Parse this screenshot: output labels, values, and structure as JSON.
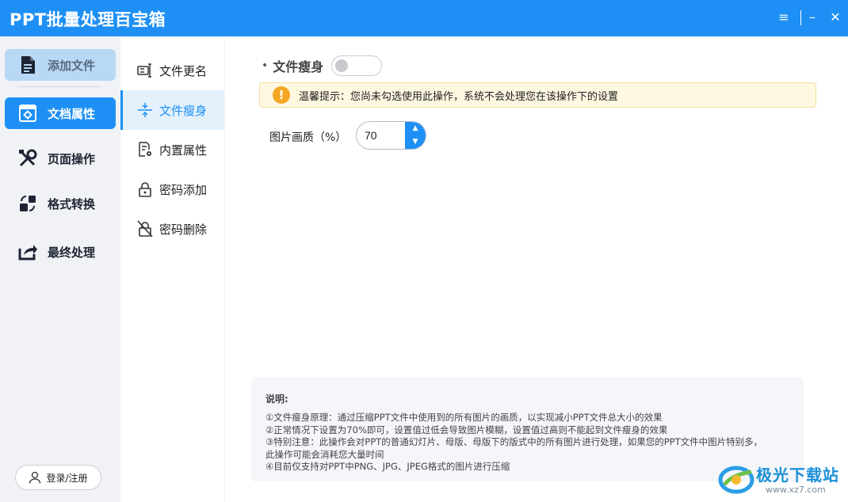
{
  "app": {
    "title": "PPT批量处理百宝箱"
  },
  "titlebar_icons": {
    "menu": "menu-icon",
    "minimize": "minimize-icon",
    "close": "close-icon"
  },
  "titlebar": {
    "menu": "≡",
    "minimize": "–",
    "close": "✕"
  },
  "sidebar": {
    "items": [
      {
        "label": "添加文件",
        "icon": "add-file-icon"
      },
      {
        "label": "文档属性",
        "icon": "document-properties-icon",
        "active": true
      },
      {
        "label": "页面操作",
        "icon": "tools-icon"
      },
      {
        "label": "格式转换",
        "icon": "format-convert-icon"
      },
      {
        "label": "最终处理",
        "icon": "share-icon"
      }
    ],
    "login_label": "登录/注册"
  },
  "subnav": {
    "items": [
      {
        "label": "文件更名",
        "icon": "rename-icon"
      },
      {
        "label": "文件瘦身",
        "icon": "compress-icon",
        "active": true
      },
      {
        "label": "内置属性",
        "icon": "builtin-properties-icon"
      },
      {
        "label": "密码添加",
        "icon": "lock-icon"
      },
      {
        "label": "密码删除",
        "icon": "unlock-icon"
      }
    ]
  },
  "content": {
    "option_bullet": "•",
    "option_label": "文件瘦身",
    "toggle_on": false,
    "notice_icon": "!",
    "notice": "温馨提示：您尚未勾选使用此操作，系统不会处理您在该操作下的设置",
    "quality_label": "图片画质（%）",
    "quality_value": "70",
    "spin_up": "▲",
    "spin_down": "▼",
    "note": {
      "title": "说明:",
      "lines": [
        "①文件瘦身原理：通过压缩PPT文件中使用到的所有图片的画质，以实现减小PPT文件总大小的效果",
        "②正常情况下设置为70%即可，设置值过低会导致图片模糊，设置值过高则不能起到文件瘦身的效果",
        "③特别注意：此操作会对PPT的普通幻灯片、母版、母版下的版式中的所有图片进行处理，如果您的PPT文件中图片特别多，",
        "此操作可能会消耗您大量时间",
        "④目前仅支持对PPT中PNG、JPG、JPEG格式的图片进行压缩"
      ]
    }
  },
  "watermark": {
    "text": "极光下载站",
    "url": "www.xz7.com"
  },
  "colors": {
    "accent": "#1e90f5",
    "sidebar_bg": "#f0f2f5",
    "notice_bg": "#fff8e1",
    "warn": "#f5a623"
  }
}
